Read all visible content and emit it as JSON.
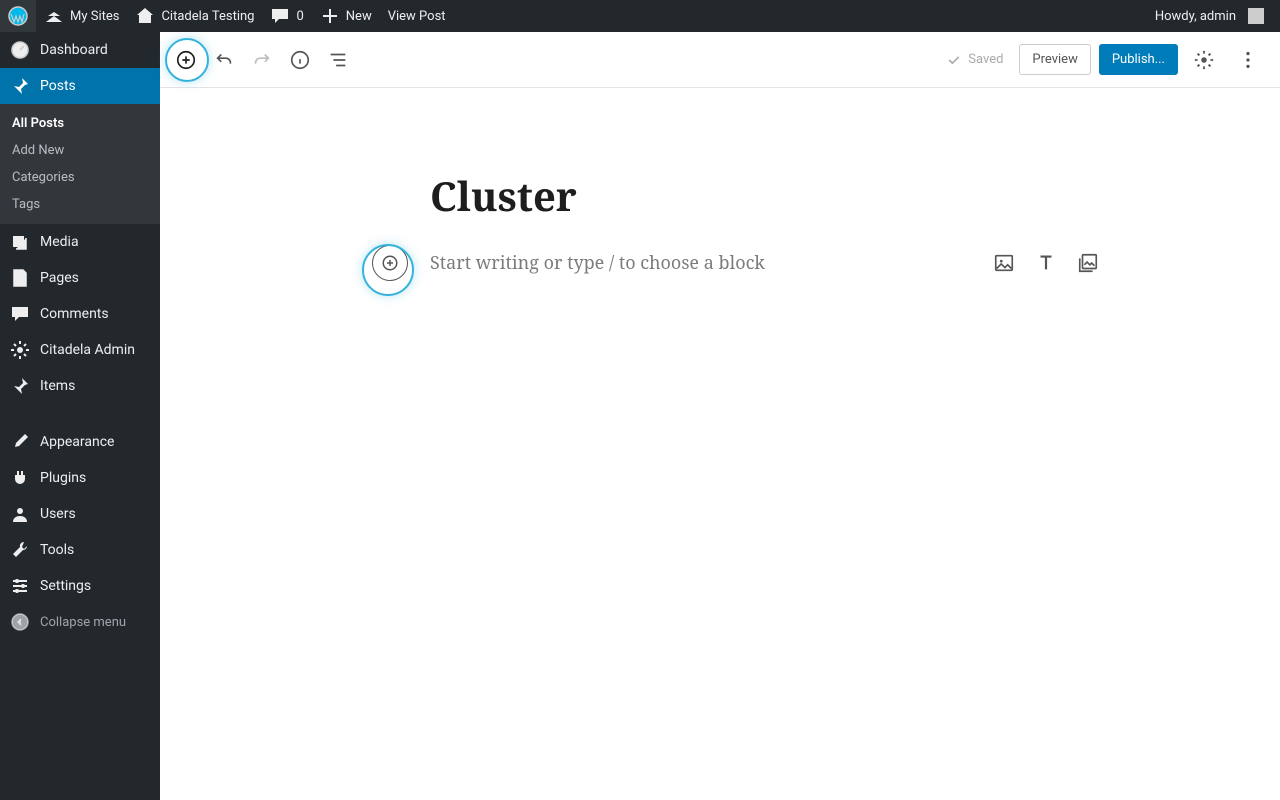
{
  "adminbar": {
    "my_sites": "My Sites",
    "site_name": "Citadela Testing",
    "comments_count": "0",
    "new_label": "New",
    "view_post": "View Post",
    "howdy": "Howdy, admin"
  },
  "sidebar": {
    "items": [
      {
        "label": "Dashboard"
      },
      {
        "label": "Posts"
      },
      {
        "label": "Media"
      },
      {
        "label": "Pages"
      },
      {
        "label": "Comments"
      },
      {
        "label": "Citadela Admin"
      },
      {
        "label": "Items"
      },
      {
        "label": "Appearance"
      },
      {
        "label": "Plugins"
      },
      {
        "label": "Users"
      },
      {
        "label": "Tools"
      },
      {
        "label": "Settings"
      }
    ],
    "posts_submenu": [
      {
        "label": "All Posts"
      },
      {
        "label": "Add New"
      },
      {
        "label": "Categories"
      },
      {
        "label": "Tags"
      }
    ],
    "collapse": "Collapse menu"
  },
  "editor": {
    "title": "Cluster",
    "paragraph_placeholder": "Start writing or type / to choose a block",
    "saved_label": "Saved",
    "preview_label": "Preview",
    "publish_label": "Publish..."
  }
}
